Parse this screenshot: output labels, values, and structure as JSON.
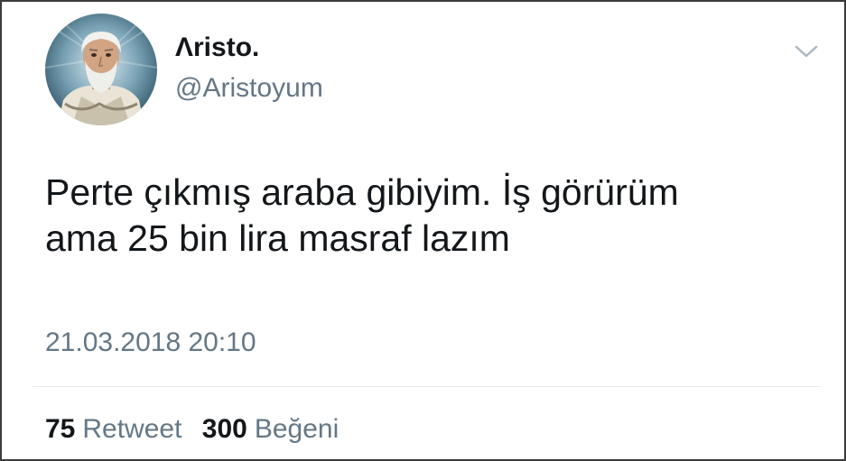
{
  "tweet": {
    "author": {
      "display_name": "Λristo.",
      "handle": "@Aristoyum",
      "avatar_icon": "aristotle-portrait-avatar"
    },
    "menu_icon": "chevron-down-icon",
    "text_lines": [
      "Perte çıkmış araba gibiyim. İş görürüm",
      "ama 25 bin lira masraf lazım"
    ],
    "timestamp": "21.03.2018 20:10",
    "stats": {
      "retweets": {
        "count": "75",
        "label": "Retweet"
      },
      "likes": {
        "count": "300",
        "label": "Beğeni"
      }
    }
  },
  "colors": {
    "text_primary": "#14171a",
    "text_secondary": "#657786",
    "divider": "#e6ecf0"
  }
}
